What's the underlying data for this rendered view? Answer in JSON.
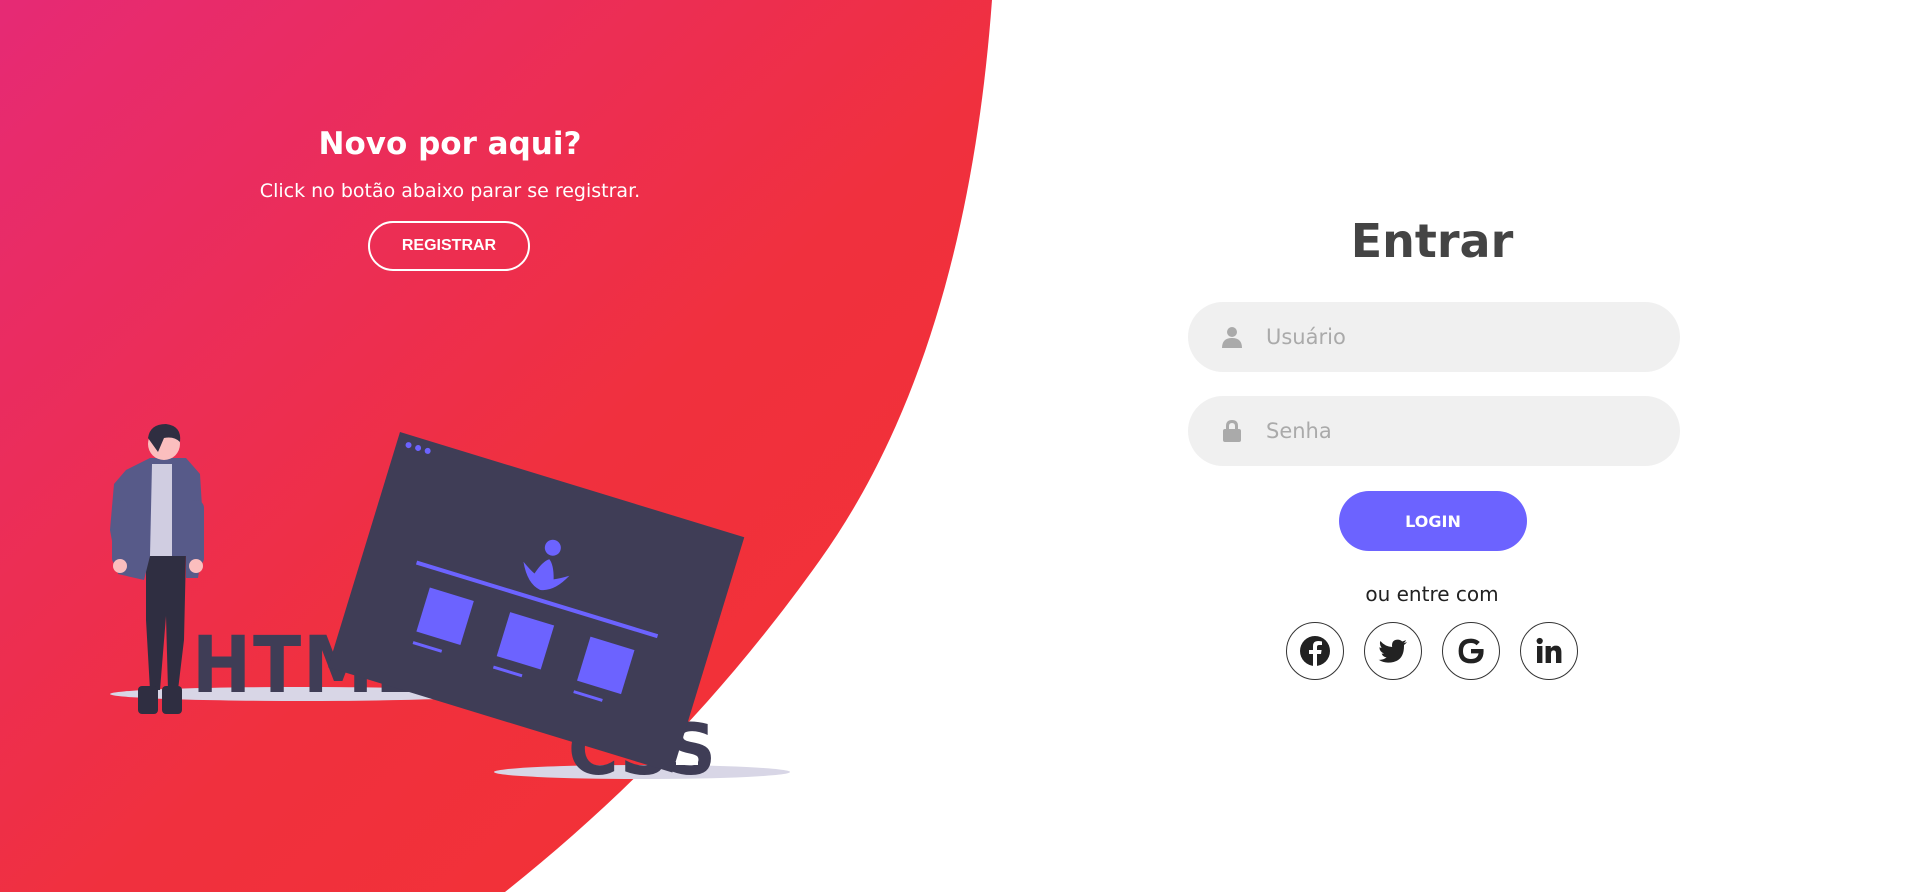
{
  "left_panel": {
    "title": "Novo por aqui?",
    "subtitle": "Click no botão abaixo parar se registrar.",
    "register_label": "REGISTRAR",
    "illustration": {
      "word_html": "HTML",
      "word_css": "CSS"
    }
  },
  "login_form": {
    "title": "Entrar",
    "username": {
      "placeholder": "Usuário",
      "value": "",
      "icon": "user-icon"
    },
    "password": {
      "placeholder": "Senha",
      "value": "",
      "icon": "lock-icon"
    },
    "login_label": "LOGIN",
    "social_text": "ou entre com",
    "social": [
      {
        "name": "facebook",
        "icon": "facebook-icon"
      },
      {
        "name": "twitter",
        "icon": "twitter-icon"
      },
      {
        "name": "google",
        "icon": "google-icon"
      },
      {
        "name": "linkedin",
        "icon": "linkedin-icon"
      }
    ]
  },
  "colors": {
    "gradient_start": "#e62a75",
    "gradient_end": "#f43232",
    "accent": "#6c63ff",
    "input_bg": "#f0f0f0",
    "title_text": "#444444",
    "illustration_dark": "#3f3d56"
  }
}
